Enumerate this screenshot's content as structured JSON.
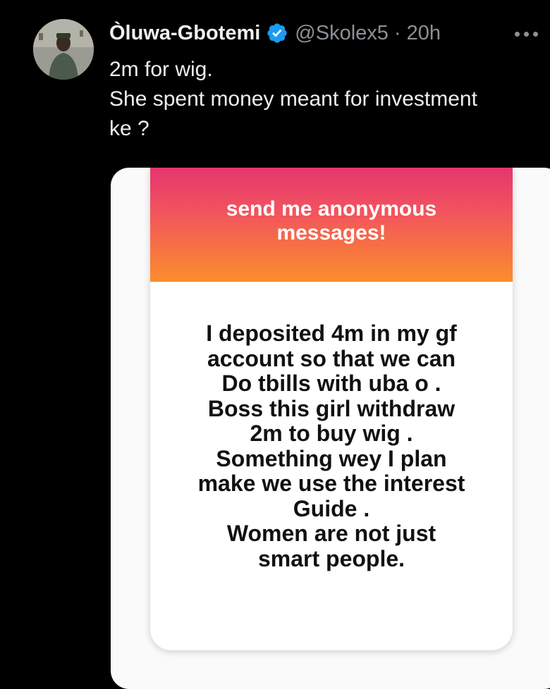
{
  "tweet": {
    "display_name": "Òluwa-Gbotemi",
    "handle": "@Skolex5",
    "separator": "·",
    "time": "20h",
    "verified_icon": "verified-badge-icon",
    "more_icon": "more-options-icon",
    "text_lines": [
      "2m for wig.",
      "She spent money meant for investment",
      "ke ?"
    ]
  },
  "story_card": {
    "title": "send me anonymous messages!",
    "message_lines": [
      "I deposited 4m in my gf",
      "account so that we can",
      "Do tbills with uba o .",
      "Boss this girl withdraw",
      "2m to buy wig .",
      "Something wey I plan",
      "make we use the interest",
      "Guide .",
      "Women are not just",
      "smart people."
    ]
  },
  "colors": {
    "background": "#000000",
    "verified": "#1d9bf0",
    "muted_text": "#8b9197",
    "gradient_top": "#e6356f",
    "gradient_bottom": "#fb8d2c"
  }
}
